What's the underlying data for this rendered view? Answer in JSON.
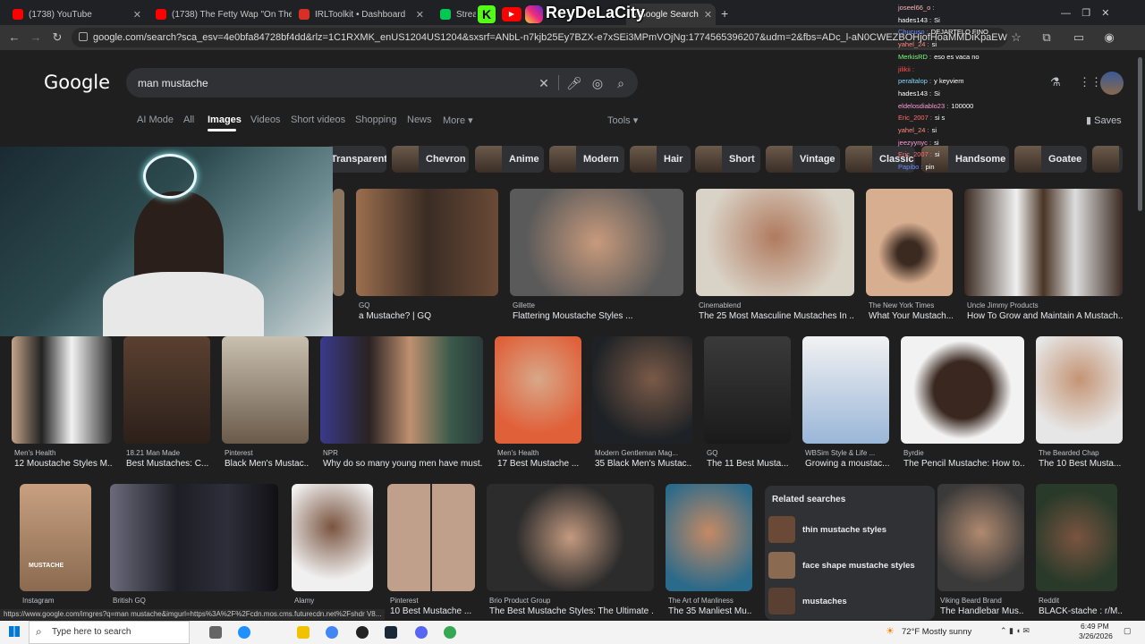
{
  "tabs": [
    {
      "label": "(1738) YouTube",
      "color": "#ff0000"
    },
    {
      "label": "(1738) The Fetty Wap \"On The",
      "color": "#ff0000"
    },
    {
      "label": "IRLToolkit • Dashboard",
      "color": "#d93025"
    },
    {
      "label": "Stream",
      "color": "#00c853"
    },
    {
      "label": "- Google Search",
      "color": "#4285f4"
    }
  ],
  "stream_overlay": {
    "name": "ReyDeLaCity"
  },
  "address": "google.com/search?sca_esv=4e0bfa84728bf4dd&rlz=1C1RXMK_enUS1204US1204&sxsrf=ANbL-n7kjb25Ey7BZX-e7xSEi3MPmVOjNg:1774565396207&udm=2&fbs=ADc_l-aN0CWEZBOHjofHoaMMDiKpaEWjvZ2Py1XXV8d8KvlI3vWHtYx0U2dlcpFIT...",
  "google": {
    "logo": "Google",
    "query": "man mustache"
  },
  "nav": {
    "items": [
      "AI Mode",
      "All",
      "Images",
      "Videos",
      "Short videos",
      "Shopping",
      "News",
      "More ▾"
    ],
    "tools": "Tools ▾",
    "saves": "Saves"
  },
  "chips": [
    "Transparent",
    "Chevron",
    "Anime",
    "Modern",
    "Hair",
    "Short",
    "Vintage",
    "Classic",
    "Handsome",
    "Goatee"
  ],
  "row1": [
    {
      "src": "GQ",
      "cap": "a Mustache? | GQ"
    },
    {
      "src": "Gillette",
      "cap": "Flattering Moustache Styles ..."
    },
    {
      "src": "Cinemablend",
      "cap": "The 25 Most Masculine Mustaches In ..."
    },
    {
      "src": "The New York Times",
      "cap": "What Your Mustach..."
    },
    {
      "src": "Uncle Jimmy Products",
      "cap": "How To Grow and Maintain A Mustach..."
    }
  ],
  "row2": [
    {
      "src": "Men's Health",
      "cap": "12 Moustache Styles M..."
    },
    {
      "src": "18.21 Man Made",
      "cap": "Best Mustaches: C..."
    },
    {
      "src": "Pinterest",
      "cap": "Black Men's Mustac..."
    },
    {
      "src": "NPR",
      "cap": "Why do so many young men have must..."
    },
    {
      "src": "Men's Health",
      "cap": "17 Best Mustache ..."
    },
    {
      "src": "Modern Gentleman Mag...",
      "cap": "35 Black Men's Mustac..."
    },
    {
      "src": "GQ",
      "cap": "The 11 Best Musta..."
    },
    {
      "src": "WBSim Style & Life ...",
      "cap": "Growing a moustac..."
    },
    {
      "src": "Byrdie",
      "cap": "The Pencil Mustache: How to..."
    },
    {
      "src": "The Bearded Chap",
      "cap": "The 10 Best Musta..."
    }
  ],
  "row3": [
    {
      "src": "Instagram",
      "cap": ""
    },
    {
      "src": "British GQ",
      "cap": ""
    },
    {
      "src": "Alamy",
      "cap": ""
    },
    {
      "src": "Pinterest",
      "cap": "10 Best Mustache ..."
    },
    {
      "src": "Brio Product Group",
      "cap": "The Best Mustache Styles: The Ultimate ..."
    },
    {
      "src": "The Art of Manliness",
      "cap": "The 35 Manliest Mu..."
    },
    {
      "src": "Viking Beard Brand",
      "cap": "The Handlebar Mus..."
    },
    {
      "src": "Reddit",
      "cap": "BLACK-stache : r/M..."
    }
  ],
  "overlay_text": "MUSTACHE",
  "related": {
    "title": "Related searches",
    "items": [
      "thin mustache styles",
      "face shape mustache styles",
      "mustaches"
    ]
  },
  "status_url": "https://www.google.com/imgres?q=man mustache&imgurl=https%3A%2F%2Fcdn.mos.cms.futurecdn.net%2Fshdr V8...",
  "chat": [
    {
      "user": "joseel66_o :",
      "msg": "",
      "c": "#ffb3b3"
    },
    {
      "user": "hades143 :",
      "msg": "Si",
      "c": "#fff"
    },
    {
      "user": "Chucuso :",
      "msg": "DEJARTELO FINO",
      "c": "#6b8cff"
    },
    {
      "user": "yahel_24 :",
      "msg": "si",
      "c": "#ff8a80"
    },
    {
      "user": "MerkisRD :",
      "msg": "eso es vaca no",
      "c": "#7cfc7c"
    },
    {
      "user": "jilikii :",
      "msg": "",
      "c": "#ff5252"
    },
    {
      "user": "peraltalop :",
      "msg": "y keyviem",
      "c": "#80d8ff"
    },
    {
      "user": "hades143 :",
      "msg": "Si",
      "c": "#fff"
    },
    {
      "user": "eldelosdiablo23 :",
      "msg": "100000",
      "c": "#ff9ed8"
    },
    {
      "user": "Eric_2007 :",
      "msg": "si s",
      "c": "#ff6e6e"
    },
    {
      "user": "yahel_24 :",
      "msg": "si",
      "c": "#ff8a80"
    },
    {
      "user": "jeezyynyc :",
      "msg": "si",
      "c": "#ff9ed8"
    },
    {
      "user": "Eric_2007 :",
      "msg": "si",
      "c": "#ff6e6e"
    },
    {
      "user": "Papibo :",
      "msg": "pin",
      "c": "#6b8cff"
    }
  ],
  "taskbar": {
    "search": "Type here to search",
    "weather": "72°F  Mostly sunny",
    "time": "6:49 PM",
    "date": "3/26/2026"
  }
}
